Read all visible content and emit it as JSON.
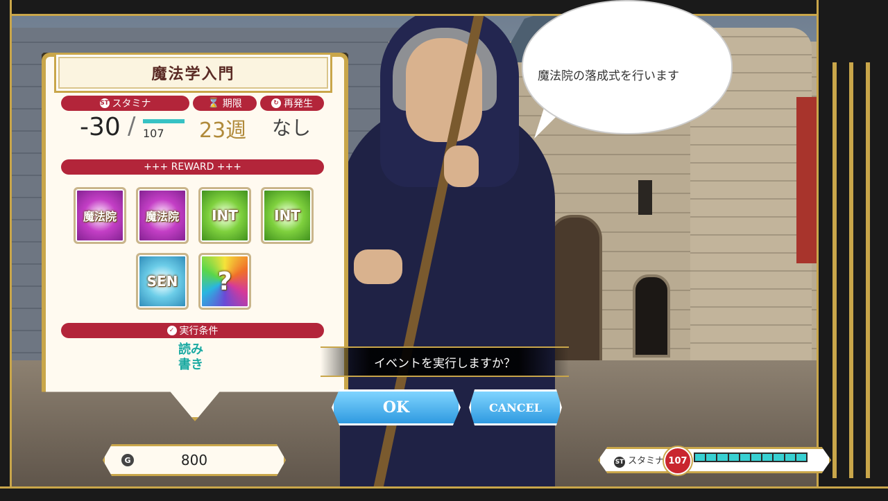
{
  "event": {
    "title": "魔法学入門",
    "stamina_label": "スタミナ",
    "stamina_cost": "-30",
    "stamina_max": "107",
    "deadline_label": "期限",
    "deadline_value": "23週",
    "recur_label": "再発生",
    "recur_value": "なし",
    "reward_label": "+++ REWARD +++",
    "rewards": [
      "魔法院",
      "魔法院",
      "INT",
      "INT",
      "SEN",
      "?"
    ],
    "condition_label": "実行条件",
    "condition_value": "読み書き"
  },
  "dialog": {
    "speech": "魔法院の落成式を行います",
    "question": "イベントを実行しますか？",
    "ok_label": "OK",
    "cancel_label": "CANCEL"
  },
  "status": {
    "gold_icon": "G",
    "gold": "800",
    "stamina_label": "スタミナ",
    "stamina_value": "107",
    "stamina_fill": 1.0
  },
  "colors": {
    "accent_red": "#b3253a",
    "frame_gold": "#c9a64a",
    "button_blue": "#2f9ae0"
  }
}
